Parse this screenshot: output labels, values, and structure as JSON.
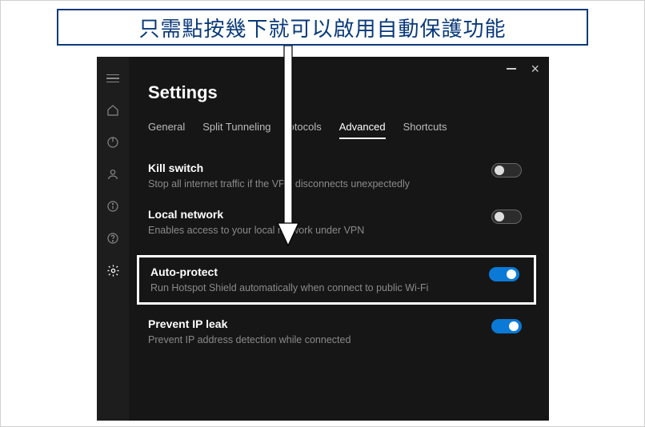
{
  "banner": {
    "text": "只需點按幾下就可以啟用自動保護功能"
  },
  "page": {
    "title": "Settings"
  },
  "tabs": [
    {
      "id": "general",
      "label": "General",
      "active": false
    },
    {
      "id": "split",
      "label": "Split Tunneling",
      "active": false
    },
    {
      "id": "protocols",
      "label": "otocols",
      "active": false
    },
    {
      "id": "advanced",
      "label": "Advanced",
      "active": true
    },
    {
      "id": "shortcuts",
      "label": "Shortcuts",
      "active": false
    }
  ],
  "settings": {
    "kill_switch": {
      "title": "Kill switch",
      "desc": "Stop all internet traffic if the VPN disconnects unexpectedly",
      "on": false
    },
    "local_network": {
      "title": "Local network",
      "desc": "Enables access to your local network under VPN",
      "on": false
    },
    "auto_protect": {
      "title": "Auto-protect",
      "desc": "Run Hotspot Shield automatically when connect to public Wi-Fi",
      "on": true
    },
    "prevent_ip_leak": {
      "title": "Prevent IP leak",
      "desc": "Prevent IP address detection while connected",
      "on": true
    }
  },
  "sidebar_icons": [
    "menu",
    "home",
    "power",
    "user",
    "info",
    "help",
    "settings"
  ],
  "colors": {
    "accent": "#0a7ad6",
    "bg": "#161616"
  }
}
